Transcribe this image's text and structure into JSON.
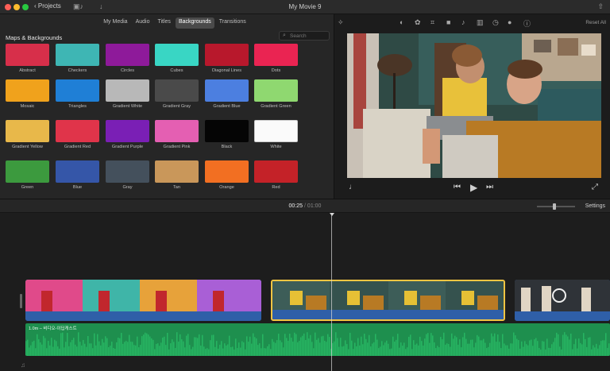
{
  "window": {
    "back_label": "Projects",
    "title": "My Movie 9"
  },
  "browser": {
    "tabs": [
      {
        "label": "My Media",
        "active": false
      },
      {
        "label": "Audio",
        "active": false
      },
      {
        "label": "Titles",
        "active": false
      },
      {
        "label": "Backgrounds",
        "active": true
      },
      {
        "label": "Transitions",
        "active": false
      }
    ],
    "section_title": "Maps & Backgrounds",
    "search_placeholder": "Search",
    "tiles": [
      {
        "label": "Abstract",
        "color": "#d72f4a"
      },
      {
        "label": "Checkers",
        "color": "#3eb6b4"
      },
      {
        "label": "Circles",
        "color": "#8e1a9a"
      },
      {
        "label": "Cubes",
        "color": "#39d6c4"
      },
      {
        "label": "Diagonal Lines",
        "color": "#b8182c"
      },
      {
        "label": "Dots",
        "color": "#ea2452"
      },
      {
        "label": "Mosaic",
        "color": "#f0a21c"
      },
      {
        "label": "Triangles",
        "color": "#1f7fd6"
      },
      {
        "label": "Gradient White",
        "color": "#b8b8b8"
      },
      {
        "label": "Gradient Gray",
        "color": "#4a4a4a"
      },
      {
        "label": "Gradient Blue",
        "color": "#4c7fe0"
      },
      {
        "label": "Gradient Green",
        "color": "#8fd870"
      },
      {
        "label": "Gradient Yellow",
        "color": "#e8b84a"
      },
      {
        "label": "Gradient Red",
        "color": "#e0344a"
      },
      {
        "label": "Gradient Purple",
        "color": "#7a1fb5"
      },
      {
        "label": "Gradient Pink",
        "color": "#e45fb2"
      },
      {
        "label": "Black",
        "color": "#050505"
      },
      {
        "label": "White",
        "color": "#fafafa"
      },
      {
        "label": "Green",
        "color": "#3c9a3e"
      },
      {
        "label": "Blue",
        "color": "#3556a8"
      },
      {
        "label": "Gray",
        "color": "#44505c"
      },
      {
        "label": "Tan",
        "color": "#c9975a"
      },
      {
        "label": "Orange",
        "color": "#f26f22"
      },
      {
        "label": "Red",
        "color": "#c42228"
      }
    ]
  },
  "viewer": {
    "reset_label": "Reset All"
  },
  "timeline": {
    "current_time": "00:25",
    "separator": "/",
    "total_time": "01:00",
    "settings_label": "Settings",
    "audio_label": "1.0m – 비디오-이딥캐스트"
  }
}
